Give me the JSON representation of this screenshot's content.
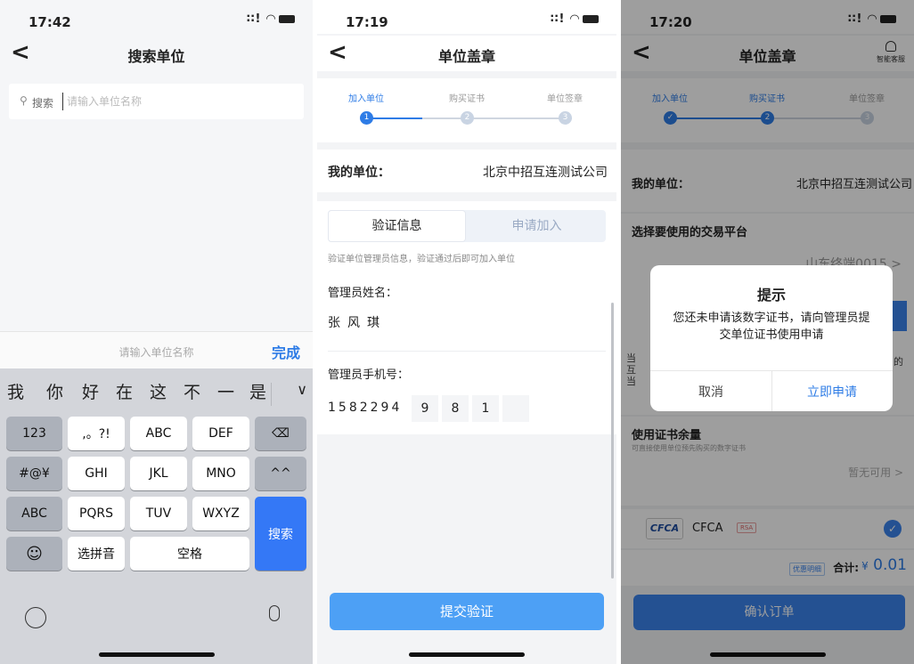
{
  "screen1": {
    "time": "17:42",
    "signal": "∶∶! ◠",
    "title": "搜索单位",
    "back_glyph": "<",
    "search": {
      "icon": "search-icon",
      "label": "搜索",
      "placeholder": "请输入单位名称"
    },
    "accessory": {
      "placeholder": "请输入单位名称",
      "done": "完成"
    },
    "candidates": [
      "我",
      "你",
      "好",
      "在",
      "这",
      "不",
      "一",
      "是"
    ],
    "candidate_expand": "∨",
    "keys": {
      "r1": [
        "123",
        ",。?!",
        "ABC",
        "DEF",
        "⌫"
      ],
      "r2": [
        "#@¥",
        "GHI",
        "JKL",
        "MNO",
        "^^"
      ],
      "r3": [
        "ABC",
        "PQRS",
        "TUV",
        "WXYZ",
        "搜索"
      ],
      "r4": [
        "☺",
        "选拼音",
        "空格"
      ]
    }
  },
  "screen2": {
    "time": "17:19",
    "signal": "∶∶! ◠",
    "title": "单位盖章",
    "back_glyph": "<",
    "steps": [
      {
        "label": "加入单位",
        "num": "1"
      },
      {
        "label": "购买证书",
        "num": "2"
      },
      {
        "label": "单位签章",
        "num": "3"
      }
    ],
    "unit_label": "我的单位：",
    "unit_value": "北京中招互连测试公司",
    "tabs": [
      "验证信息",
      "申请加入"
    ],
    "hint": "验证单位管理员信息，验证通过后即可加入单位",
    "admin_name_label": "管理员姓名：",
    "admin_name": [
      "张",
      "风",
      "琪"
    ],
    "admin_phone_label": "管理员手机号：",
    "phone_prefix": "1582294",
    "phone_cells": [
      "9",
      "8",
      "1",
      ""
    ],
    "submit": "提交验证"
  },
  "screen3": {
    "time": "17:20",
    "signal": "∶∶! ◠",
    "title": "单位盖章",
    "back_glyph": "<",
    "support": "智能客服",
    "steps": [
      {
        "label": "加入单位",
        "num": "✓"
      },
      {
        "label": "购买证书",
        "num": "2"
      },
      {
        "label": "单位签章",
        "num": "3"
      }
    ],
    "unit_label": "我的单位：",
    "unit_value": "北京中招互连测试公司",
    "platform_title": "选择要使用的交易平台",
    "platform_value": "山东终端0015 >",
    "side_text_left": [
      "当",
      "互",
      "当"
    ],
    "side_text_right": "的",
    "cert_title": "使用证书余量",
    "cert_sub": "可直接使用单位预先购买的数字证书",
    "cert_avail": "暂无可用  >",
    "cfca_logo": "CFCA",
    "cfca_name": "CFCA",
    "rsa": "RSA",
    "check": "✓",
    "discount": "优惠明细",
    "total_label": "合计:",
    "currency": "¥",
    "total_value": "0.01",
    "confirm": "确认订单",
    "dialog": {
      "title": "提示",
      "message": "您还未申请该数字证书，请向管理员提交单位证书使用申请",
      "cancel": "取消",
      "apply": "立即申请"
    }
  },
  "colors": {
    "accent": "#2e7ce6",
    "button": "#4da0f5",
    "keyboard": "#d3d5da"
  }
}
